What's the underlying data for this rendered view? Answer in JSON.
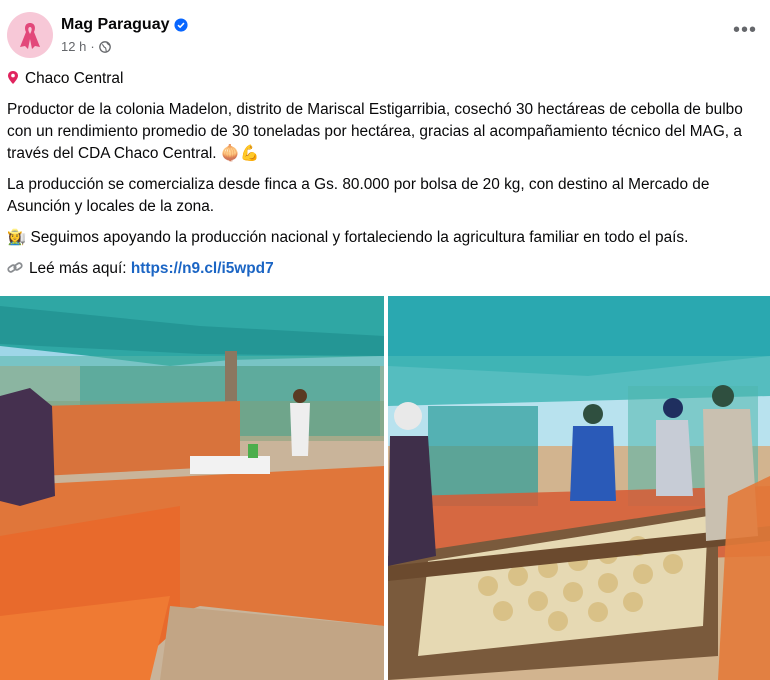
{
  "post": {
    "page_name": "Mag Paraguay",
    "time": "12 h",
    "separator": "·",
    "more": "•••",
    "location": "Chaco Central",
    "paragraph1": "Productor de la colonia Madelon, distrito de Mariscal Estigarribia, cosechó 30 hectáreas de cebolla de bulbo con un rendimiento promedio de 30 toneladas por hectárea, gracias al acompañamiento técnico del MAG, a través del CDA Chaco Central.",
    "paragraph1_emoji": "🧅💪",
    "paragraph2": "La producción se comercializa desde finca a Gs. 80.000 por bolsa de 20 kg, con destino al Mercado de Asunción y locales de la zona.",
    "paragraph3": "Seguimos apoyando la producción nacional y fortaleciendo la agricultura familiar en todo el país.",
    "paragraph3_emoji": "👩‍🌾",
    "read_more_label": "Leé más aquí:",
    "read_more_link": "https://n9.cl/i5wpd7"
  },
  "icons": {
    "location": "pin-icon",
    "link": "link-icon",
    "verified": "verified-badge-icon",
    "privacy": "globe-icon",
    "avatar": "pink-ribbon-icon"
  },
  "colors": {
    "link": "#1b65c4",
    "secondary_text": "#65676b",
    "verified": "#0866ff",
    "avatar_bg": "#f7c8d7",
    "ribbon": "#e2487a"
  }
}
